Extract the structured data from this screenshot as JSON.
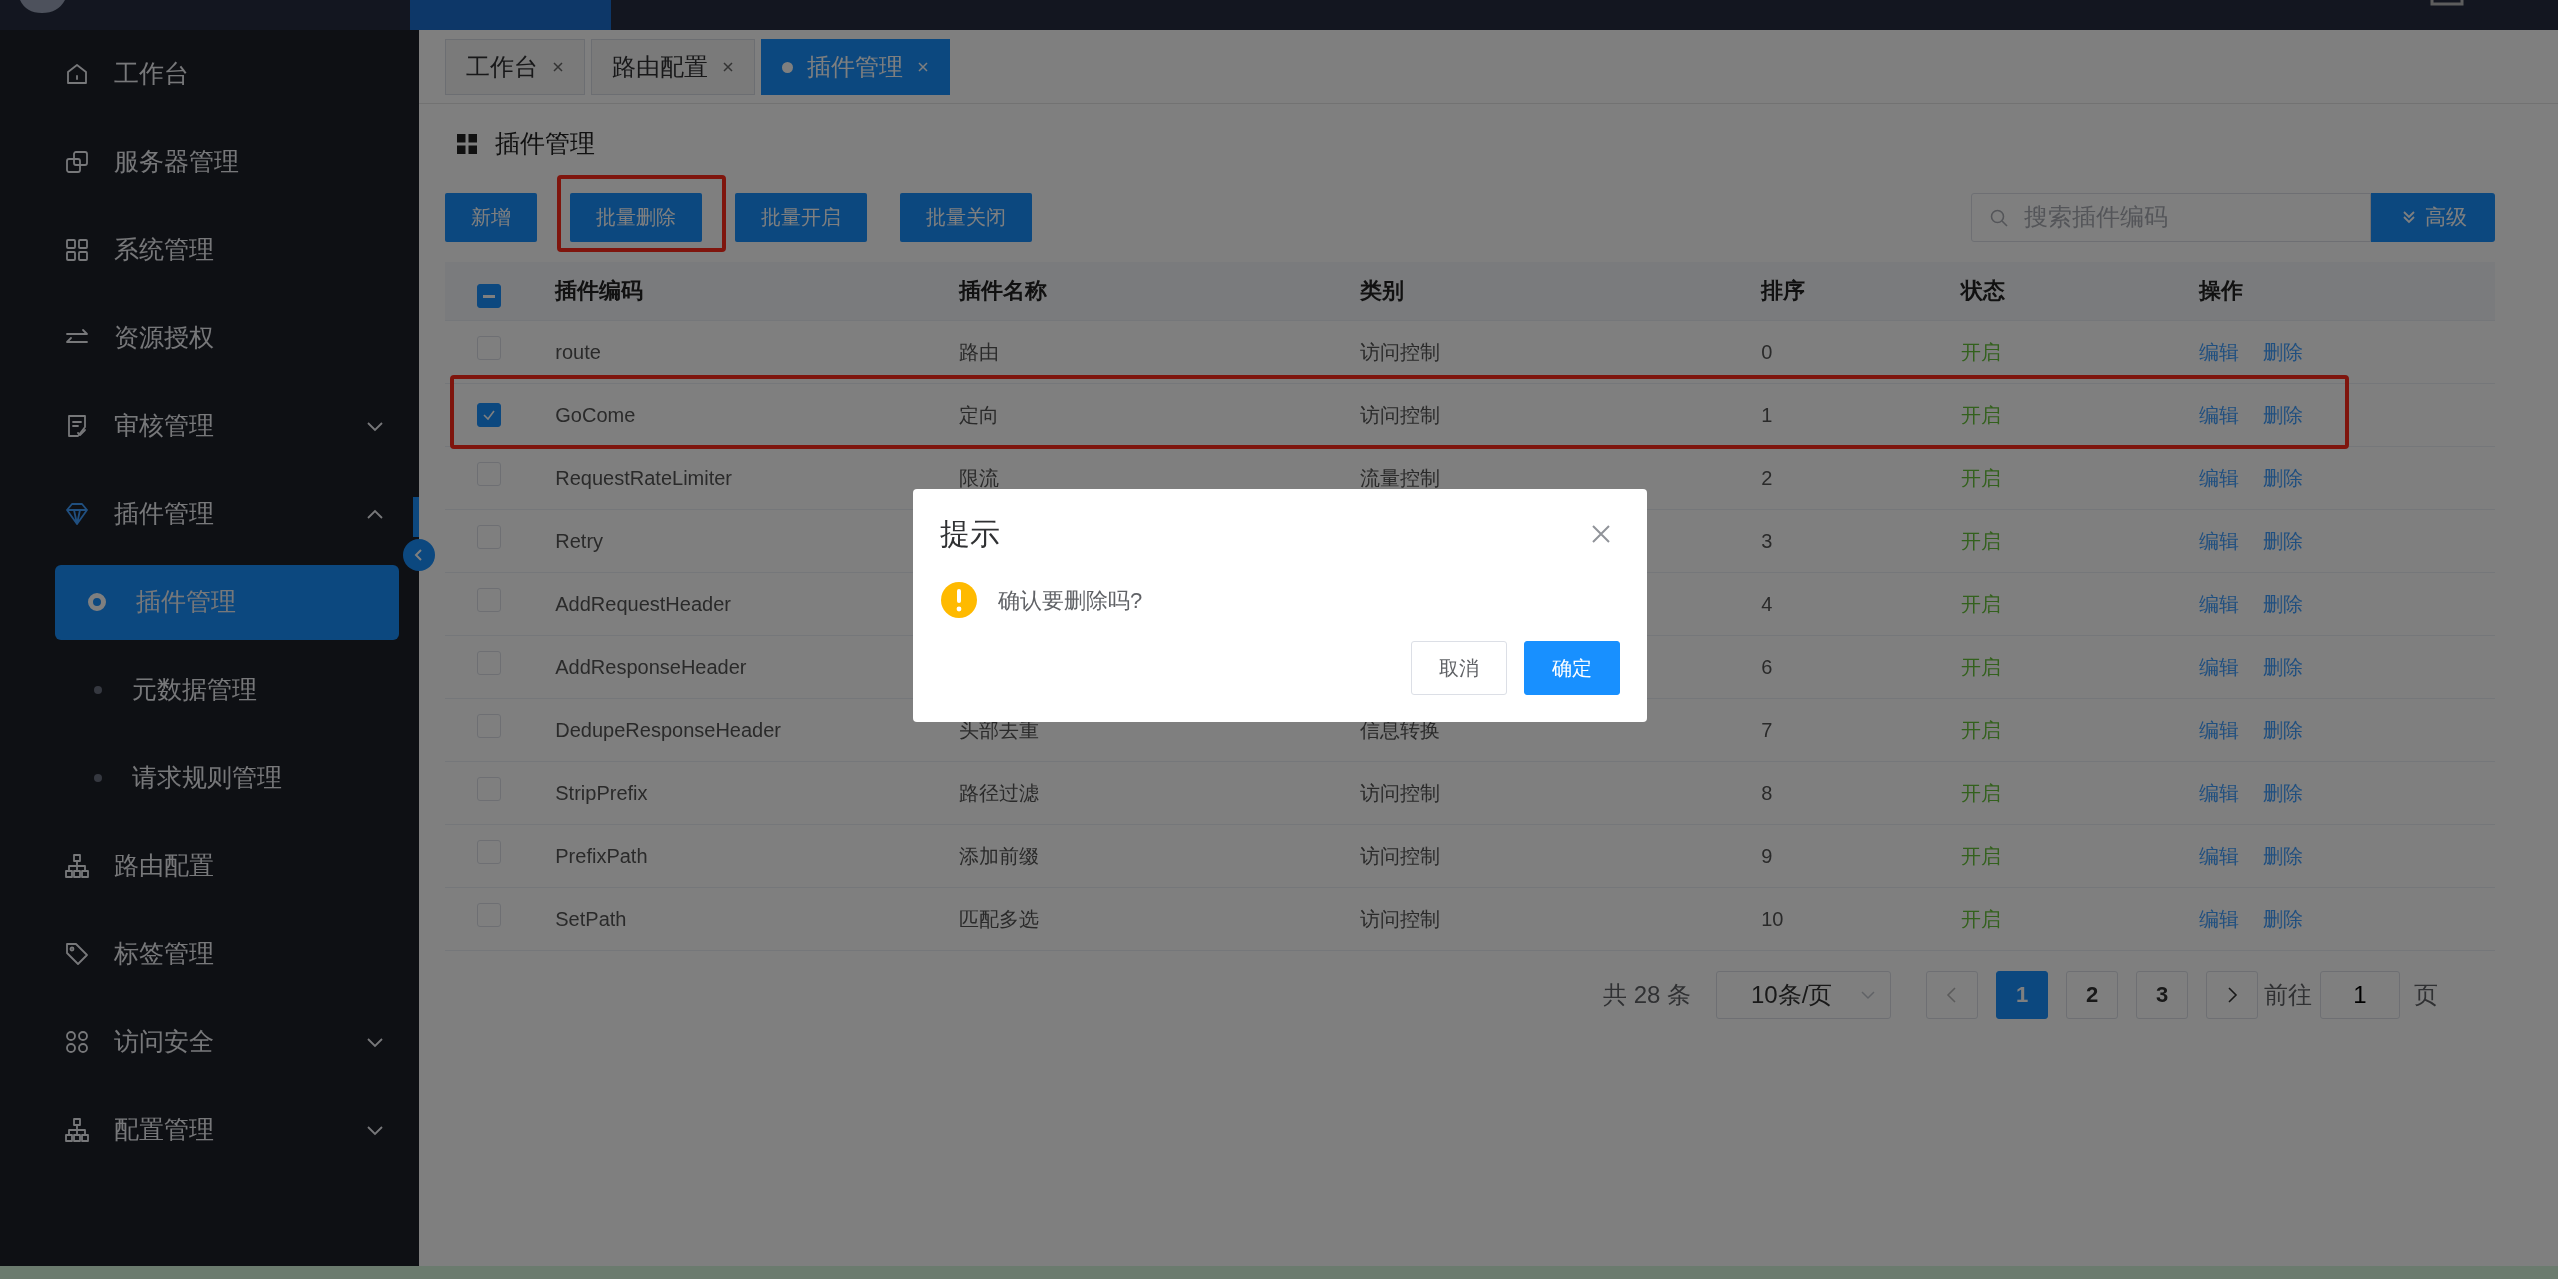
{
  "sidebar": {
    "items": [
      {
        "label": "工作台",
        "selected": false
      },
      {
        "label": "服务器管理",
        "selected": false
      },
      {
        "label": "系统管理",
        "selected": false
      },
      {
        "label": "资源授权",
        "selected": false
      },
      {
        "label": "审核管理",
        "selected": false,
        "expanded": false
      },
      {
        "label": "插件管理",
        "selected": true,
        "expanded": true,
        "children": [
          {
            "label": "插件管理",
            "selected": true
          },
          {
            "label": "元数据管理",
            "selected": false
          },
          {
            "label": "请求规则管理",
            "selected": false
          }
        ]
      },
      {
        "label": "路由配置",
        "selected": false
      },
      {
        "label": "标签管理",
        "selected": false
      },
      {
        "label": "访问安全",
        "selected": false,
        "expanded": false
      },
      {
        "label": "配置管理",
        "selected": false,
        "expanded": false
      }
    ]
  },
  "tabs": [
    {
      "label": "工作台",
      "selected": false
    },
    {
      "label": "路由配置",
      "selected": false
    },
    {
      "label": "插件管理",
      "selected": true
    }
  ],
  "page_title": "插件管理",
  "toolbar": {
    "buttons": [
      {
        "label": "新增",
        "highlighted": false
      },
      {
        "label": "批量删除",
        "highlighted": true
      },
      {
        "label": "批量开启",
        "highlighted": false
      },
      {
        "label": "批量关闭",
        "highlighted": false
      }
    ],
    "search": {
      "placeholder": "搜索插件编码"
    },
    "advanced_button": "高级"
  },
  "table": {
    "header_checkbox": {
      "indeterminate": true
    },
    "columns": [
      "插件编码",
      "插件名称",
      "类别",
      "排序",
      "状态",
      "操作"
    ],
    "rows": [
      {
        "checked": false,
        "highlighted": false,
        "code": "route",
        "name": "路由",
        "category": "访问控制",
        "order": "0",
        "status": "开启",
        "actions": [
          "编辑",
          "删除"
        ]
      },
      {
        "checked": true,
        "highlighted": true,
        "code": "GoCome",
        "name": "定向",
        "category": "访问控制",
        "order": "1",
        "status": "开启",
        "actions": [
          "编辑",
          "删除"
        ]
      },
      {
        "checked": false,
        "highlighted": false,
        "code": "RequestRateLimiter",
        "name": "限流",
        "category": "流量控制",
        "order": "2",
        "status": "开启",
        "actions": [
          "编辑",
          "删除"
        ]
      },
      {
        "checked": false,
        "highlighted": false,
        "code": "Retry",
        "order": "3",
        "status": "开启",
        "actions": [
          "编辑",
          "删除"
        ]
      },
      {
        "checked": false,
        "highlighted": false,
        "code": "AddRequestHeader",
        "order": "4",
        "status": "开启",
        "actions": [
          "编辑",
          "删除"
        ]
      },
      {
        "checked": false,
        "highlighted": false,
        "code": "AddResponseHeader",
        "order": "6",
        "status": "开启",
        "actions": [
          "编辑",
          "删除"
        ]
      },
      {
        "checked": false,
        "highlighted": false,
        "code": "DedupeResponseHeader",
        "name": "头部去重",
        "category": "信息转换",
        "order": "7",
        "status": "开启",
        "actions": [
          "编辑",
          "删除"
        ]
      },
      {
        "checked": false,
        "highlighted": false,
        "code": "StripPrefix",
        "name": "路径过滤",
        "category": "访问控制",
        "order": "8",
        "status": "开启",
        "actions": [
          "编辑",
          "删除"
        ]
      },
      {
        "checked": false,
        "highlighted": false,
        "code": "PrefixPath",
        "name": "添加前缀",
        "category": "访问控制",
        "order": "9",
        "status": "开启",
        "actions": [
          "编辑",
          "删除"
        ]
      },
      {
        "checked": false,
        "highlighted": false,
        "code": "SetPath",
        "name": "匹配多选",
        "category": "访问控制",
        "order": "10",
        "status": "开启",
        "actions": [
          "编辑",
          "删除"
        ]
      }
    ]
  },
  "pagination": {
    "total": "共 28 条",
    "page_size": "10条/页",
    "prev_disabled": true,
    "next_disabled": false,
    "pages": [
      {
        "label": "1",
        "selected": true
      },
      {
        "label": "2",
        "selected": false
      },
      {
        "label": "3",
        "selected": false
      }
    ],
    "goto_label": "前往",
    "goto_value": "1",
    "page_suffix": "页"
  },
  "dialog": {
    "title": "提示",
    "message": "确认要删除吗?",
    "buttons": [
      {
        "label": "取消",
        "kind": "default"
      },
      {
        "label": "确定",
        "kind": "primary"
      }
    ]
  }
}
